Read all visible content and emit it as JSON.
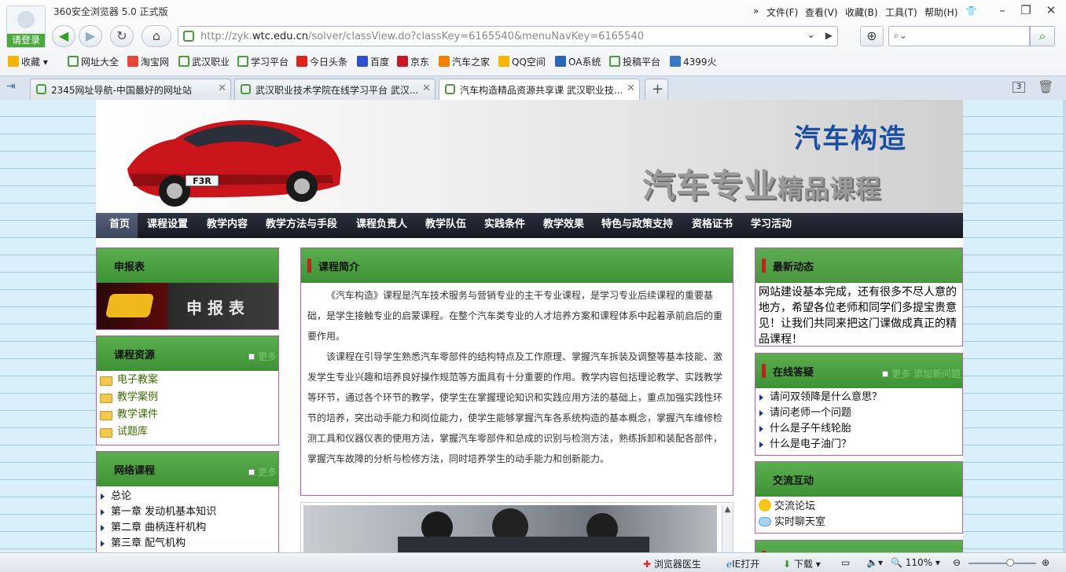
{
  "browser": {
    "title": "360安全浏览器 5.0 正式版",
    "login": "请登录",
    "menus": [
      "文件(F)",
      "查看(V)",
      "收藏(B)",
      "工具(T)",
      "帮助(H)"
    ],
    "url_prefix": "http://zyk.",
    "url_host": "wtc.edu.cn",
    "url_rest": "/solver/classView.do?classKey=6165540&menuNavKey=6165540",
    "bookmarks": [
      "收藏",
      "网址大全",
      "淘宝网",
      "武汉职业",
      "学习平台",
      "今日头条",
      "百度",
      "京东",
      "汽车之家",
      "QQ空间",
      "OA系统",
      "投稿平台",
      "4399火"
    ],
    "tabs": [
      "2345网址导航-中国最好的网址站",
      "武汉职业技术学院在线学习平台 武汉...",
      "汽车构造精品资源共享课 武汉职业技..."
    ],
    "tab_count": "3"
  },
  "banner": {
    "title": "汽车构造",
    "subtitle_big": "汽车专业",
    "subtitle_small": "精品课程",
    "plate": "F3R"
  },
  "nav": [
    "首页",
    "课程设置",
    "教学内容",
    "教学方法与手段",
    "课程负责人",
    "教学队伍",
    "实践条件",
    "教学效果",
    "特色与政策支持",
    "资格证书",
    "学习活动"
  ],
  "left": {
    "shenbao_title": "申报表",
    "shenbao_img_text": "申 报 表",
    "resources_title": "课程资源",
    "more": "更多",
    "resources": [
      "电子教案",
      "教学案例",
      "教学课件",
      "试题库"
    ],
    "network_title": "网络课程",
    "network": [
      "总论",
      "第一章 发动机基本知识",
      "第二章 曲柄连杆机构",
      "第三章 配气机构"
    ]
  },
  "center": {
    "intro_title": "课程简介",
    "para1": "《汽车构造》课程是汽车技术服务与营销专业的主干专业课程，是学习专业后续课程的重要基础，是学生接触专业的启蒙课程。在整个汽车类专业的人才培养方案和课程体系中起着承前启后的重要作用。",
    "para2": "该课程在引导学生熟悉汽车零部件的结构特点及工作原理、掌握汽车拆装及调整等基本技能、激发学生专业兴趣和培养良好操作规范等方面具有十分重要的作用。教学内容包括理论教学、实践教学等环节，通过各个环节的教学，使学生在掌握理论知识和实践应用方法的基础上，重点加强实践性环节的培养，突出动手能力和岗位能力，使学生能够掌握汽车各系统构造的基本概念，掌握汽车维修检测工具和仪器仪表的使用方法，掌握汽车零部件和总成的识别与检测方法，熟练拆卸和装配各部件，掌握汽车故障的分析与检修方法，同时培养学生的动手能力和创新能力。"
  },
  "right": {
    "news_title": "最新动态",
    "news_text": "网站建设基本完成，还有很多不尽人意的地方，希望各位老师和同学们多提宝贵意见！让我们共同来把这门课做成真正的精品课程！",
    "qa_title": "在线答疑",
    "qa_more": "更多 添加新问题",
    "qa": [
      "请问双领降是什么意思？",
      "请问老师一个问题",
      "什么是子午线轮胎",
      "什么是电子油门？"
    ],
    "interact_title": "交流互动",
    "interact": [
      "交流论坛",
      "实时聊天室"
    ]
  },
  "status": {
    "doctor": "浏览器医生",
    "ie": "IE打开",
    "download": "下载",
    "zoom": "110%"
  },
  "colors": {
    "accent": "#4aa83f",
    "header_green": "#4c9f42",
    "nav_dark": "#1e222c",
    "box_border": "#b55faf"
  }
}
